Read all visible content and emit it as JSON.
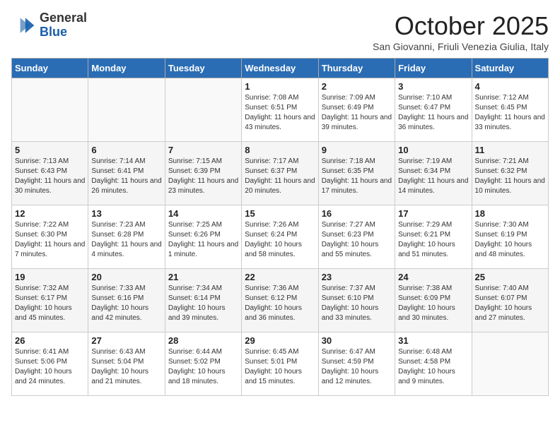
{
  "logo": {
    "general": "General",
    "blue": "Blue"
  },
  "title": "October 2025",
  "subtitle": "San Giovanni, Friuli Venezia Giulia, Italy",
  "days_of_week": [
    "Sunday",
    "Monday",
    "Tuesday",
    "Wednesday",
    "Thursday",
    "Friday",
    "Saturday"
  ],
  "weeks": [
    [
      {
        "day": "",
        "info": ""
      },
      {
        "day": "",
        "info": ""
      },
      {
        "day": "",
        "info": ""
      },
      {
        "day": "1",
        "info": "Sunrise: 7:08 AM\nSunset: 6:51 PM\nDaylight: 11 hours and 43 minutes."
      },
      {
        "day": "2",
        "info": "Sunrise: 7:09 AM\nSunset: 6:49 PM\nDaylight: 11 hours and 39 minutes."
      },
      {
        "day": "3",
        "info": "Sunrise: 7:10 AM\nSunset: 6:47 PM\nDaylight: 11 hours and 36 minutes."
      },
      {
        "day": "4",
        "info": "Sunrise: 7:12 AM\nSunset: 6:45 PM\nDaylight: 11 hours and 33 minutes."
      }
    ],
    [
      {
        "day": "5",
        "info": "Sunrise: 7:13 AM\nSunset: 6:43 PM\nDaylight: 11 hours and 30 minutes."
      },
      {
        "day": "6",
        "info": "Sunrise: 7:14 AM\nSunset: 6:41 PM\nDaylight: 11 hours and 26 minutes."
      },
      {
        "day": "7",
        "info": "Sunrise: 7:15 AM\nSunset: 6:39 PM\nDaylight: 11 hours and 23 minutes."
      },
      {
        "day": "8",
        "info": "Sunrise: 7:17 AM\nSunset: 6:37 PM\nDaylight: 11 hours and 20 minutes."
      },
      {
        "day": "9",
        "info": "Sunrise: 7:18 AM\nSunset: 6:35 PM\nDaylight: 11 hours and 17 minutes."
      },
      {
        "day": "10",
        "info": "Sunrise: 7:19 AM\nSunset: 6:34 PM\nDaylight: 11 hours and 14 minutes."
      },
      {
        "day": "11",
        "info": "Sunrise: 7:21 AM\nSunset: 6:32 PM\nDaylight: 11 hours and 10 minutes."
      }
    ],
    [
      {
        "day": "12",
        "info": "Sunrise: 7:22 AM\nSunset: 6:30 PM\nDaylight: 11 hours and 7 minutes."
      },
      {
        "day": "13",
        "info": "Sunrise: 7:23 AM\nSunset: 6:28 PM\nDaylight: 11 hours and 4 minutes."
      },
      {
        "day": "14",
        "info": "Sunrise: 7:25 AM\nSunset: 6:26 PM\nDaylight: 11 hours and 1 minute."
      },
      {
        "day": "15",
        "info": "Sunrise: 7:26 AM\nSunset: 6:24 PM\nDaylight: 10 hours and 58 minutes."
      },
      {
        "day": "16",
        "info": "Sunrise: 7:27 AM\nSunset: 6:23 PM\nDaylight: 10 hours and 55 minutes."
      },
      {
        "day": "17",
        "info": "Sunrise: 7:29 AM\nSunset: 6:21 PM\nDaylight: 10 hours and 51 minutes."
      },
      {
        "day": "18",
        "info": "Sunrise: 7:30 AM\nSunset: 6:19 PM\nDaylight: 10 hours and 48 minutes."
      }
    ],
    [
      {
        "day": "19",
        "info": "Sunrise: 7:32 AM\nSunset: 6:17 PM\nDaylight: 10 hours and 45 minutes."
      },
      {
        "day": "20",
        "info": "Sunrise: 7:33 AM\nSunset: 6:16 PM\nDaylight: 10 hours and 42 minutes."
      },
      {
        "day": "21",
        "info": "Sunrise: 7:34 AM\nSunset: 6:14 PM\nDaylight: 10 hours and 39 minutes."
      },
      {
        "day": "22",
        "info": "Sunrise: 7:36 AM\nSunset: 6:12 PM\nDaylight: 10 hours and 36 minutes."
      },
      {
        "day": "23",
        "info": "Sunrise: 7:37 AM\nSunset: 6:10 PM\nDaylight: 10 hours and 33 minutes."
      },
      {
        "day": "24",
        "info": "Sunrise: 7:38 AM\nSunset: 6:09 PM\nDaylight: 10 hours and 30 minutes."
      },
      {
        "day": "25",
        "info": "Sunrise: 7:40 AM\nSunset: 6:07 PM\nDaylight: 10 hours and 27 minutes."
      }
    ],
    [
      {
        "day": "26",
        "info": "Sunrise: 6:41 AM\nSunset: 5:06 PM\nDaylight: 10 hours and 24 minutes."
      },
      {
        "day": "27",
        "info": "Sunrise: 6:43 AM\nSunset: 5:04 PM\nDaylight: 10 hours and 21 minutes."
      },
      {
        "day": "28",
        "info": "Sunrise: 6:44 AM\nSunset: 5:02 PM\nDaylight: 10 hours and 18 minutes."
      },
      {
        "day": "29",
        "info": "Sunrise: 6:45 AM\nSunset: 5:01 PM\nDaylight: 10 hours and 15 minutes."
      },
      {
        "day": "30",
        "info": "Sunrise: 6:47 AM\nSunset: 4:59 PM\nDaylight: 10 hours and 12 minutes."
      },
      {
        "day": "31",
        "info": "Sunrise: 6:48 AM\nSunset: 4:58 PM\nDaylight: 10 hours and 9 minutes."
      },
      {
        "day": "",
        "info": ""
      }
    ]
  ]
}
